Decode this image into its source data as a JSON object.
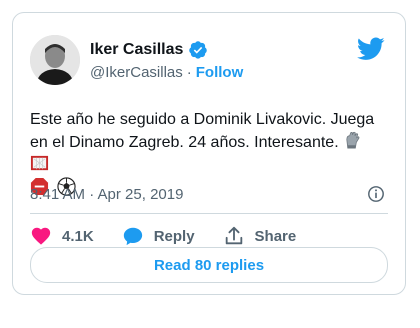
{
  "author": {
    "display_name": "Iker Casillas",
    "handle": "@IkerCasillas",
    "separator": "·",
    "follow_label": "Follow"
  },
  "tweet": {
    "text": "Este año he seguido a Dominik Livakovic. Juega en el Dinamo Zagreb. 24 años. Interesante.",
    "emojis": [
      "gloves-icon",
      "goal-icon",
      "stop-sign-icon",
      "soccer-ball-icon"
    ],
    "timestamp": "8:41 AM · Apr 25, 2019"
  },
  "actions": {
    "like_count": "4.1K",
    "reply_label": "Reply",
    "share_label": "Share"
  },
  "read_replies_label": "Read 80 replies",
  "colors": {
    "accent": "#1d9bf0",
    "like": "#f91880",
    "text": "#0f1419",
    "muted": "#536471",
    "border": "#cfd9de"
  }
}
